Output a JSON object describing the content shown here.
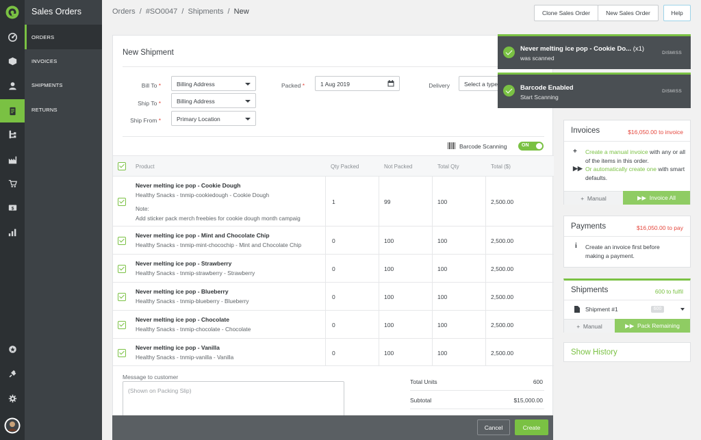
{
  "app": {
    "section_title": "Sales Orders"
  },
  "nav": {
    "items": [
      "ORDERS",
      "INVOICES",
      "SHIPMENTS",
      "RETURNS"
    ],
    "active_index": 0
  },
  "rail_icons": [
    "logo-icon",
    "dashboard-icon",
    "box-icon",
    "user-icon",
    "orders-icon",
    "hierarchy-icon",
    "factory-icon",
    "cart-icon",
    "dollar-icon",
    "reports-icon",
    "badge-icon",
    "plug-icon",
    "gear-icon",
    "avatar"
  ],
  "breadcrumb": {
    "items": [
      "Orders",
      "#SO0047",
      "Shipments"
    ],
    "current": "New",
    "sep": "/"
  },
  "header_buttons": {
    "clone": "Clone Sales Order",
    "new": "New Sales Order",
    "help": "Help"
  },
  "shipment": {
    "title": "New Shipment",
    "bill_to_label": "Bill To",
    "bill_to_value": "Billing Address",
    "ship_to_label": "Ship To",
    "ship_to_value": "Billing Address",
    "ship_from_label": "Ship From",
    "ship_from_value": "Primary Location",
    "packed_label": "Packed",
    "packed_value": "1 Aug 2019",
    "delivery_label": "Delivery",
    "delivery_value": "Select a type",
    "required_mark": "*",
    "barcode_label": "Barcode Scanning",
    "barcode_toggle": "ON"
  },
  "table": {
    "columns": [
      "Product",
      "Qty Packed",
      "Not Packed",
      "Total Qty",
      "Total ($)"
    ],
    "rows": [
      {
        "name": "Never melting ice pop - Cookie Dough",
        "sub": "Healthy Snacks - tnmip-cookiedough - Cookie Dough",
        "note_label": "Note:",
        "note": "Add sticker pack merch freebies for cookie dough month campaig",
        "packed": "1",
        "not_packed": "99",
        "total_qty": "100",
        "total": "2,500.00"
      },
      {
        "name": "Never melting ice pop - Mint and Chocolate Chip",
        "sub": "Healthy Snacks - tnmip-mint-chocochip - Mint and Chocolate Chip",
        "packed": "0",
        "not_packed": "100",
        "total_qty": "100",
        "total": "2,500.00"
      },
      {
        "name": "Never melting ice pop - Strawberry",
        "sub": "Healthy Snacks - tnmip-strawberry - Strawberry",
        "packed": "0",
        "not_packed": "100",
        "total_qty": "100",
        "total": "2,500.00"
      },
      {
        "name": "Never melting ice pop - Blueberry",
        "sub": "Healthy Snacks - tnmip-blueberry - Blueberry",
        "packed": "0",
        "not_packed": "100",
        "total_qty": "100",
        "total": "2,500.00"
      },
      {
        "name": "Never melting ice pop - Chocolate",
        "sub": "Healthy Snacks - tnmip-chocolate - Chocolate",
        "packed": "0",
        "not_packed": "100",
        "total_qty": "100",
        "total": "2,500.00"
      },
      {
        "name": "Never melting ice pop - Vanilla",
        "sub": "Healthy Snacks - tnmip-vanilla - Vanilla",
        "packed": "0",
        "not_packed": "100",
        "total_qty": "100",
        "total": "2,500.00"
      }
    ]
  },
  "footer": {
    "message_label": "Message to customer",
    "message_placeholder": "(Shown on Packing Slip)",
    "total_units_label": "Total Units",
    "total_units": "600",
    "subtotal_label": "Subtotal",
    "subtotal": "$15,000.00",
    "cancel": "Cancel",
    "create": "Create"
  },
  "toasts": [
    {
      "title": "Never melting ice pop - Cookie Do...",
      "count": "(x1)",
      "sub": "was scanned",
      "dismiss": "DISMISS"
    },
    {
      "title": "Barcode Enabled",
      "sub": "Start Scanning",
      "dismiss": "DISMISS"
    }
  ],
  "invoices": {
    "title": "Invoices",
    "amount": "$16,050.00 to invoice",
    "line1_link": "Create a manual invoice",
    "line1_rest": "with any or all of the items in this order.",
    "line2_link": "Or automatically create one",
    "line2_rest": "with smart defaults.",
    "manual": "Manual",
    "invoice_all": "Invoice All"
  },
  "payments": {
    "title": "Payments",
    "amount": "$16,050.00 to pay",
    "info": "Create an invoice first before making a payment."
  },
  "shipments": {
    "title": "Shipments",
    "amount": "600 to fulfil",
    "item": "Shipment #1",
    "badge": "600",
    "manual": "Manual",
    "pack_remaining": "Pack Remaining"
  },
  "history": {
    "label": "Show History"
  },
  "colors": {
    "accent": "#7ac143",
    "danger": "#e5473d",
    "sidebar": "#2c3033",
    "nav": "#3d4246",
    "toast": "#4a4f53"
  }
}
